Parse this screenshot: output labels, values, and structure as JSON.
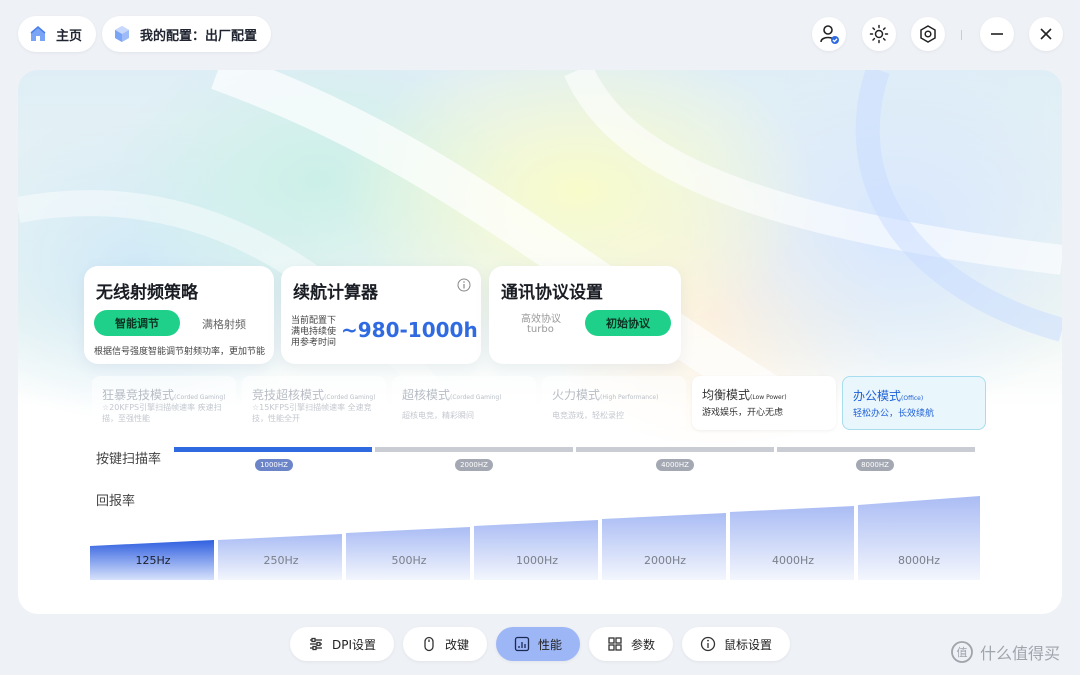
{
  "header": {
    "home_label": "主页",
    "config_label": "我的配置：出厂配置"
  },
  "cards": {
    "rf": {
      "title": "无线射频策略",
      "smart_label": "智能调节",
      "full_label": "满格射频",
      "note": "根据信号强度智能调节射频功率，更加节能"
    },
    "battery": {
      "title": "续航计算器",
      "note": "当前配置下满电持续使用参考时间",
      "value": "~980-1000h"
    },
    "protocol": {
      "title": "通讯协议设置",
      "efficient_label": "高效协议",
      "turbo_label": "turbo",
      "initial_label": "初始协议"
    }
  },
  "modes": [
    {
      "name": "狂暴竞技模式",
      "en": "(Corded Gaming)",
      "desc": "☆20KFPS引擎扫描帧速率 疾速扫描，至强性能"
    },
    {
      "name": "竞技超核模式",
      "en": "(Corded Gaming)",
      "desc": "☆15KFPS引擎扫描帧速率 全速竞技，性能全开"
    },
    {
      "name": "超核模式",
      "en": "(Corded Gaming)",
      "desc": "超核电竞，精彩瞬间"
    },
    {
      "name": "火力模式",
      "en": "(High Performance)",
      "desc": "电竞游戏，轻松录控"
    },
    {
      "name": "均衡模式",
      "en": "(Low Power)",
      "desc": "游戏娱乐，开心无虑"
    },
    {
      "name": "办公模式",
      "en": "(Office)",
      "desc": "轻松办公，长效续航"
    }
  ],
  "scan": {
    "label": "按键扫描率",
    "options": [
      "1000HZ",
      "2000HZ",
      "4000HZ",
      "8000HZ"
    ],
    "selected": 0
  },
  "report": {
    "label": "回报率",
    "options": [
      "125Hz",
      "250Hz",
      "500Hz",
      "1000Hz",
      "2000Hz",
      "4000Hz",
      "8000Hz"
    ],
    "selected": 0
  },
  "nav": {
    "dpi": "DPI设置",
    "keys": "改键",
    "perf": "性能",
    "params": "参数",
    "mouse": "鼠标设置"
  },
  "watermark": "什么值得买",
  "colors": {
    "accent_green": "#1fd08a",
    "accent_blue": "#2f6ae0",
    "nav_active": "#9db6f5"
  }
}
